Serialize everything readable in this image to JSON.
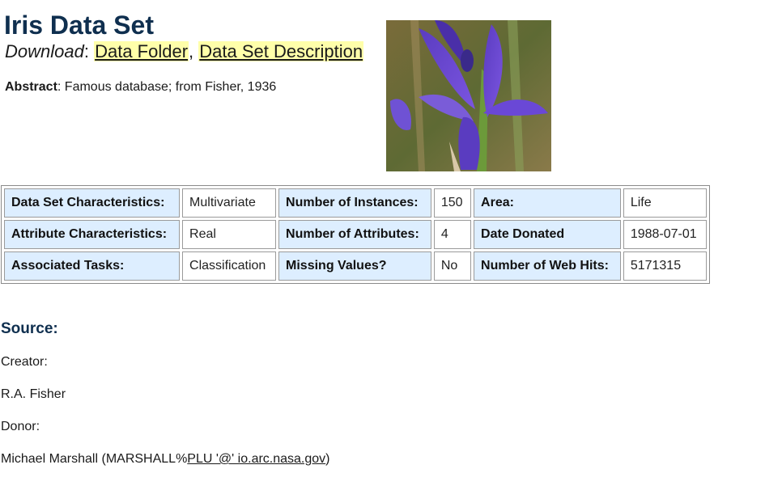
{
  "page": {
    "title": "Iris Data Set",
    "download_label": "Download",
    "download_sep": ":",
    "links": {
      "data_folder": "Data Folder",
      "comma": ",",
      "description": "Data Set Description"
    },
    "abstract_label": "Abstract",
    "abstract_text": ": Famous database; from Fisher, 1936",
    "image_icon": "iris-flower-photo"
  },
  "table": {
    "rows": [
      [
        {
          "label": "Data Set Characteristics:",
          "value": "Multivariate"
        },
        {
          "label": "Number of Instances:",
          "value": "150"
        },
        {
          "label": "Area:",
          "value": "Life"
        }
      ],
      [
        {
          "label": "Attribute Characteristics:",
          "value": "Real"
        },
        {
          "label": "Number of Attributes:",
          "value": "4"
        },
        {
          "label": "Date Donated",
          "value": "1988-07-01"
        }
      ],
      [
        {
          "label": "Associated Tasks:",
          "value": "Classification"
        },
        {
          "label": "Missing Values?",
          "value": "No"
        },
        {
          "label": "Number of Web Hits:",
          "value": "5171315"
        }
      ]
    ]
  },
  "source": {
    "heading": "Source:",
    "creator_label": "Creator:",
    "creator_name": "R.A. Fisher",
    "donor_label": "Donor:",
    "donor_prefix": "Michael Marshall (MARSHALL%",
    "donor_email": "PLU '@' io.arc.nasa.gov",
    "donor_suffix": ")"
  },
  "colors": {
    "title": "#0f2f4f",
    "link_highlight": "#ffffaa",
    "label_cell": "#ddeeff"
  }
}
